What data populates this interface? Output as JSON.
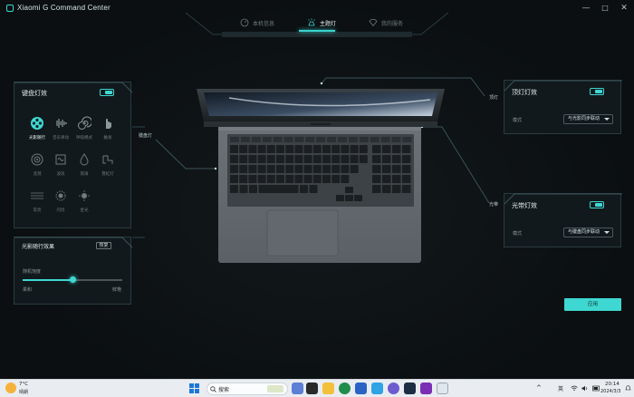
{
  "window": {
    "title": "Xiaomi G Command Center",
    "controls": [
      "—",
      "□",
      "✕"
    ]
  },
  "tabs": [
    {
      "label": "本机信息",
      "icon": "gauge-icon",
      "active": false
    },
    {
      "label": "主题灯",
      "icon": "lamp-icon",
      "active": true
    },
    {
      "label": "我的服务",
      "icon": "diamond-icon",
      "active": false
    }
  ],
  "keyboard_panel": {
    "title": "键盘灯效",
    "toggle_on": true,
    "effects": [
      {
        "label": "光影随行",
        "icon": "film-reel-icon",
        "active": true
      },
      {
        "label": "音乐律动",
        "icon": "waveform-icon",
        "active": false
      },
      {
        "label": "呼吸模式",
        "icon": "spiral-icon",
        "active": false
      },
      {
        "label": "触发",
        "icon": "touch-hand-icon",
        "active": false
      },
      {
        "label": "涟漪",
        "icon": "ripple-icon",
        "active": false
      },
      {
        "label": "波浪",
        "icon": "wave-icon",
        "active": false
      },
      {
        "label": "雨滴",
        "icon": "raindrop-icon",
        "active": false
      },
      {
        "label": "霓虹灯",
        "icon": "neon-icon",
        "active": false
      },
      {
        "label": "常亮",
        "icon": "lines-icon",
        "active": false
      },
      {
        "label": "闪烁",
        "icon": "flash-dot-icon",
        "active": false
      },
      {
        "label": "星光",
        "icon": "star-dot-icon",
        "active": false
      }
    ]
  },
  "light_follow_panel": {
    "title": "光影随行效果",
    "button": "恢复",
    "slider_label": "随机饱度",
    "slider_min_label": "柔和",
    "slider_max_label": "鲜艳",
    "slider_value_fraction": 0.5
  },
  "top_light_panel": {
    "title": "顶灯灯效",
    "toggle_on": true,
    "mode_label": "模式",
    "mode_value": "与光影同步联动"
  },
  "bar_light_panel": {
    "title": "光带灯效",
    "toggle_on": true,
    "mode_label": "模式",
    "mode_value": "与键盘同步联动"
  },
  "callouts": {
    "keyboard": "键盘灯",
    "top": "顶灯",
    "bar": "光带"
  },
  "apply_button": "应用",
  "taskbar": {
    "weather_temp": "7°C",
    "weather_desc": "晴朗",
    "search_placeholder": "搜索",
    "input_method": "英",
    "time": "20:14",
    "date": "2024/3/3"
  },
  "colors": {
    "accent": "#3fd7d2",
    "background": "#0c1012",
    "panel": "#121a1d"
  }
}
